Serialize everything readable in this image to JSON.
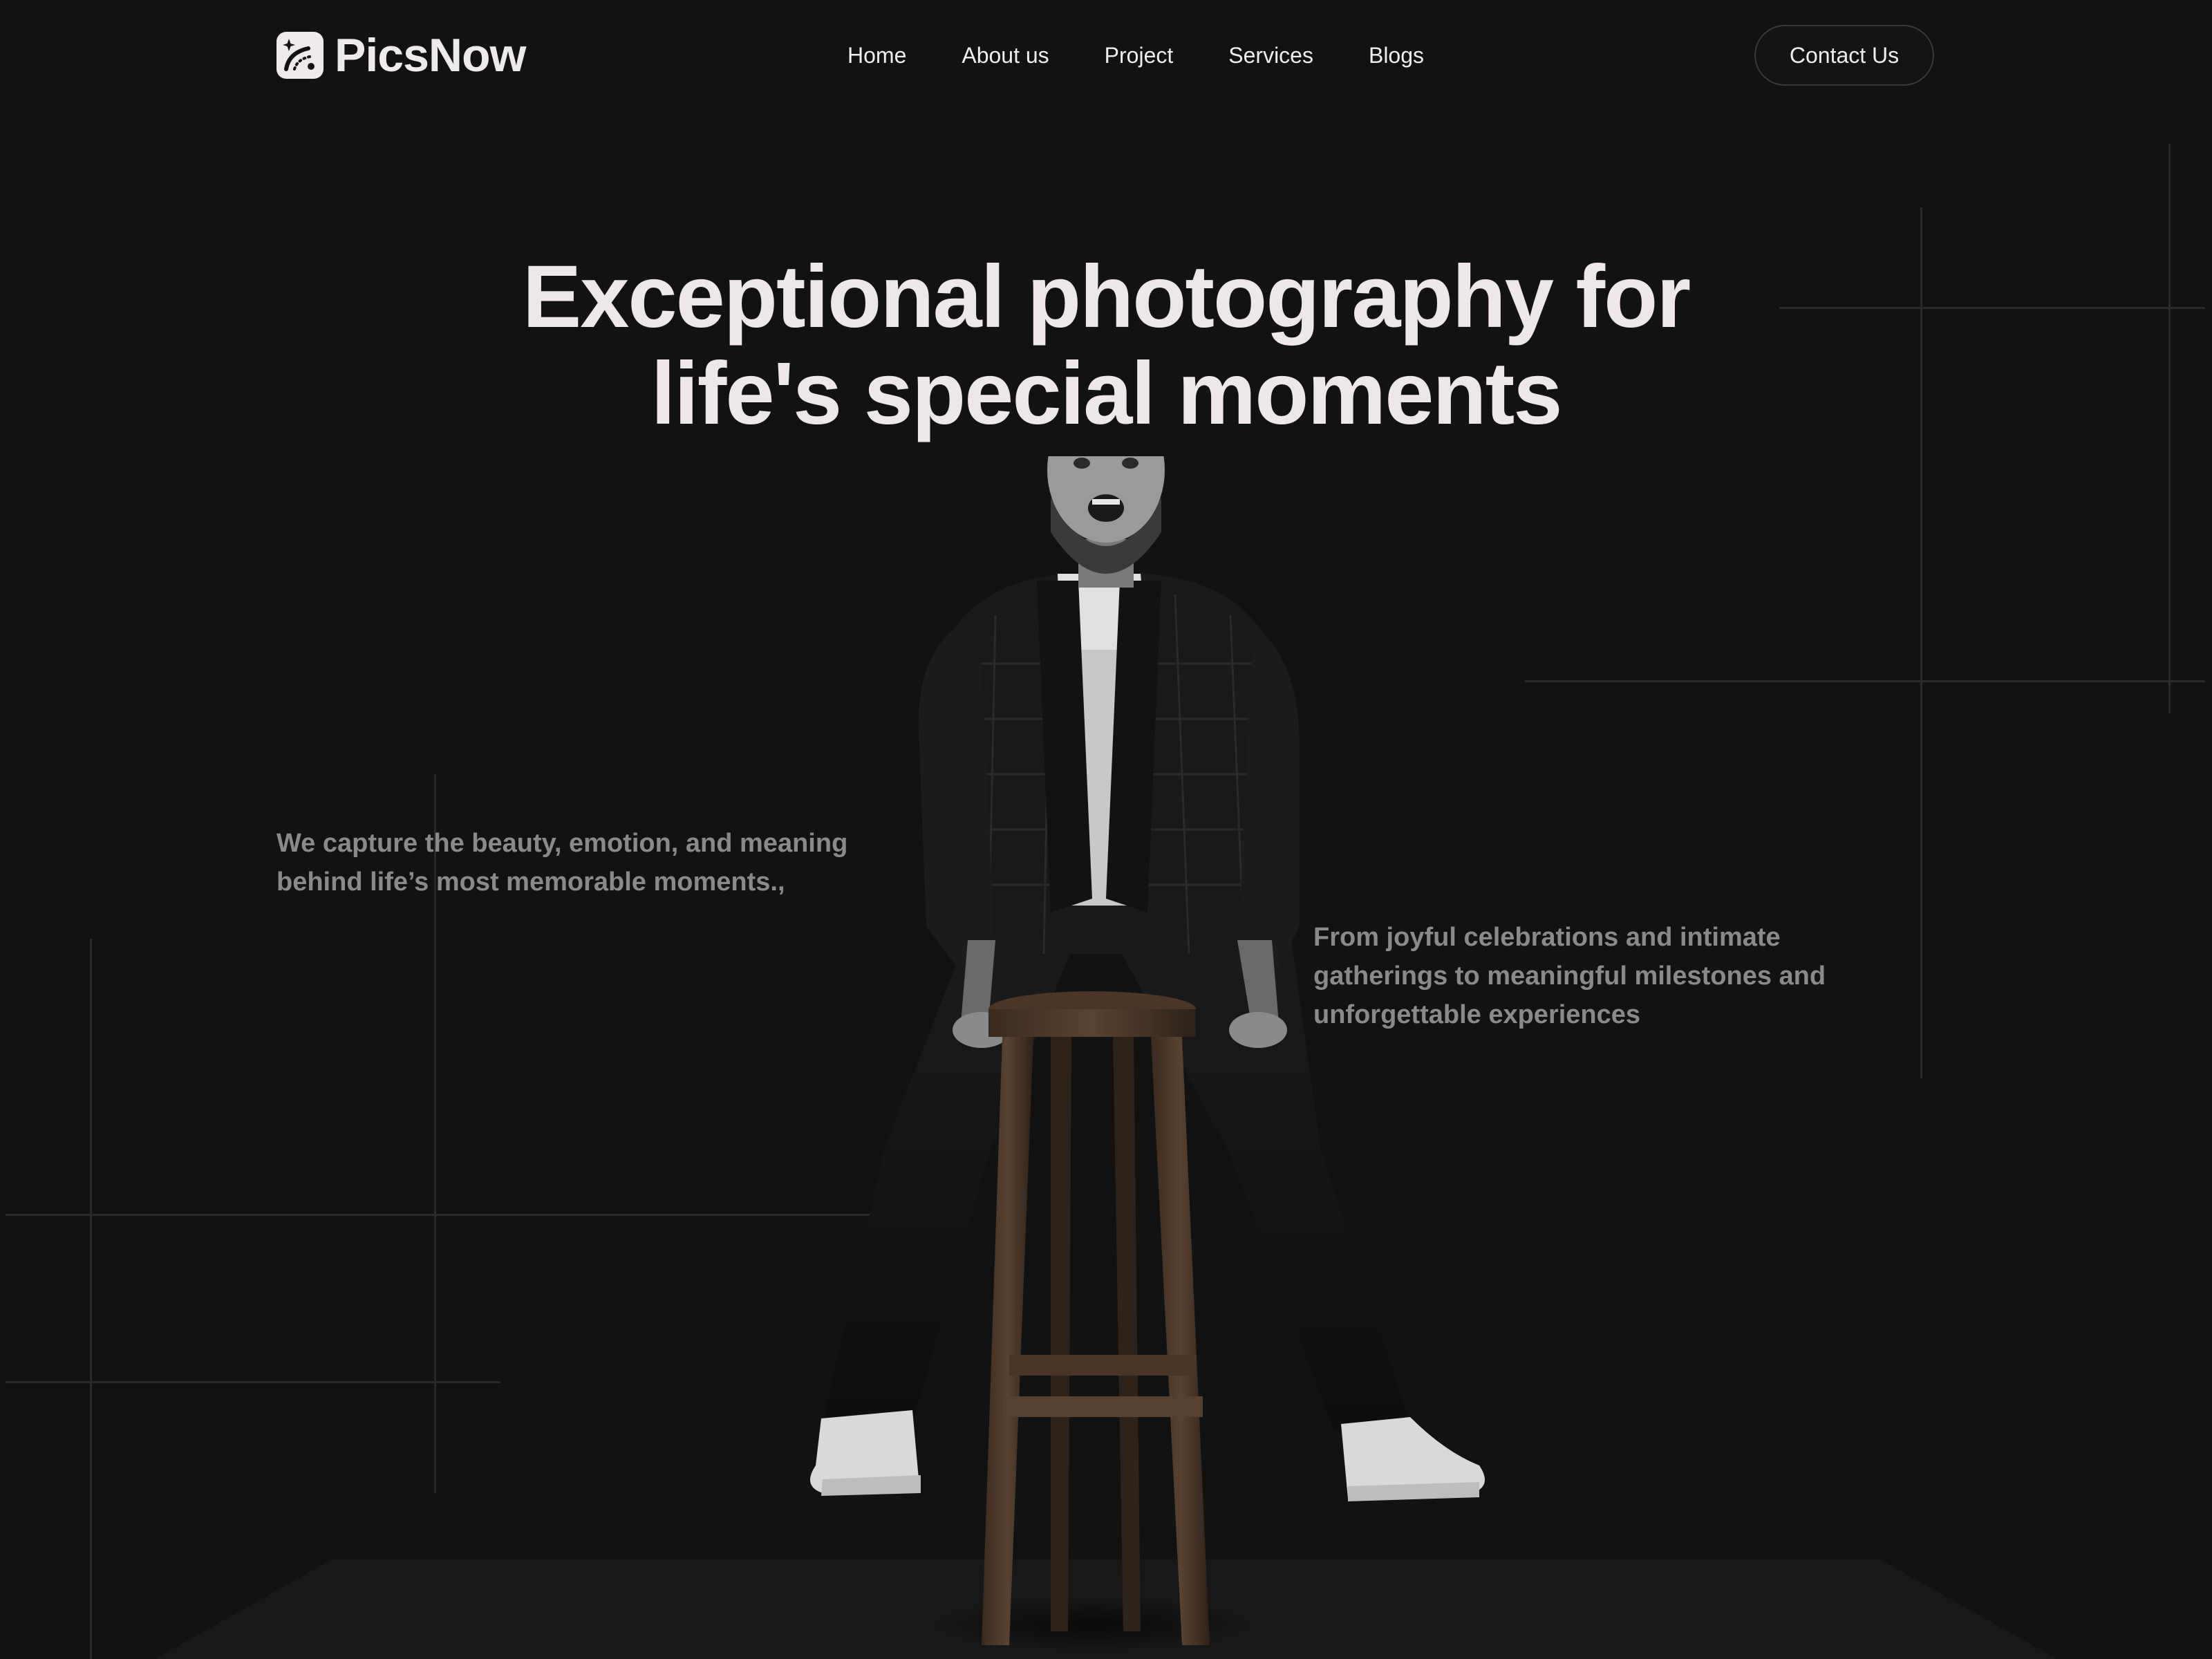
{
  "brand": {
    "name": "PicsNow",
    "icon": "camera-spark-icon"
  },
  "nav": {
    "items": [
      {
        "label": "Home"
      },
      {
        "label": "About us"
      },
      {
        "label": "Project"
      },
      {
        "label": "Services"
      },
      {
        "label": "Blogs"
      }
    ],
    "contact_label": "Contact Us"
  },
  "hero": {
    "title_line1": "Exceptional photography for",
    "title_line2": "life's special moments",
    "blurb_left": "We capture the beauty, emotion, and meaning behind life’s most memorable moments.,",
    "blurb_right": "From joyful celebrations and intimate gatherings to meaningful milestones and unforgettable experiences",
    "image_subject": "bearded-man-leaning-on-wooden-stool"
  },
  "colors": {
    "background": "#121212",
    "text_primary": "#ede7e7",
    "text_muted": "#8a8a8a",
    "grid_line": "#2a2a2a"
  }
}
